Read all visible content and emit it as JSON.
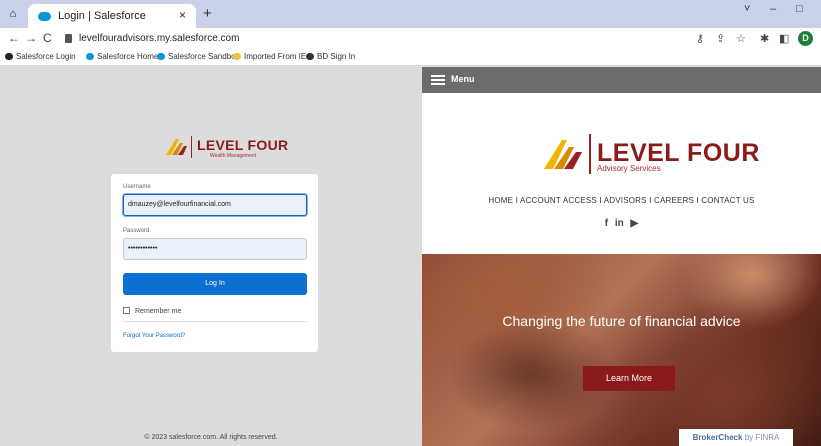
{
  "browser": {
    "tab_title": "Login | Salesforce",
    "tab_close": "×",
    "new_tab": "+",
    "url": "levelfouradvisors.my.salesforce.com",
    "profile_initial": "D",
    "window_controls": {
      "minimize": "–",
      "maximize": "□",
      "chevron": "˅"
    },
    "bookmarks": [
      {
        "label": "Salesforce Login",
        "icon": "salesforce-circle-icon"
      },
      {
        "label": "Salesforce Home",
        "icon": "salesforce-cloud-icon"
      },
      {
        "label": "Salesforce Sandbox",
        "icon": "salesforce-cloud-icon"
      },
      {
        "label": "Imported From IE",
        "icon": "folder-icon"
      },
      {
        "label": "BD Sign In",
        "icon": "gear-icon"
      }
    ]
  },
  "login": {
    "logo_text": "LEVEL FOUR",
    "logo_sub": "Wealth Management",
    "username_label": "Username",
    "username_value": "dmauzey@levelfourfinancial.com",
    "password_label": "Password",
    "password_value": "••••••••••••",
    "login_button": "Log In",
    "remember_label": "Remember me",
    "forgot_link": "Forgot Your Password?",
    "copyright": "© 2023 salesforce.com. All rights reserved."
  },
  "site": {
    "menu_label": "Menu",
    "logo_text": "LEVEL FOUR",
    "logo_sub": "Advisory Services",
    "nav_text": "HOME  I  ACCOUNT ACCESS  I  ADVISORS  I  CAREERS  I  CONTACT US",
    "social": {
      "facebook": "f",
      "linkedin": "in",
      "youtube": "▶"
    },
    "hero_title": "Changing the future of financial advice",
    "learn_more": "Learn More",
    "brokercheck": "BrokerCheck",
    "brokercheck_by": "by FINRA"
  },
  "colors": {
    "brand_red": "#8b1a1a",
    "salesforce_blue": "#0b70d1",
    "menu_gray": "#6c6c6c"
  }
}
